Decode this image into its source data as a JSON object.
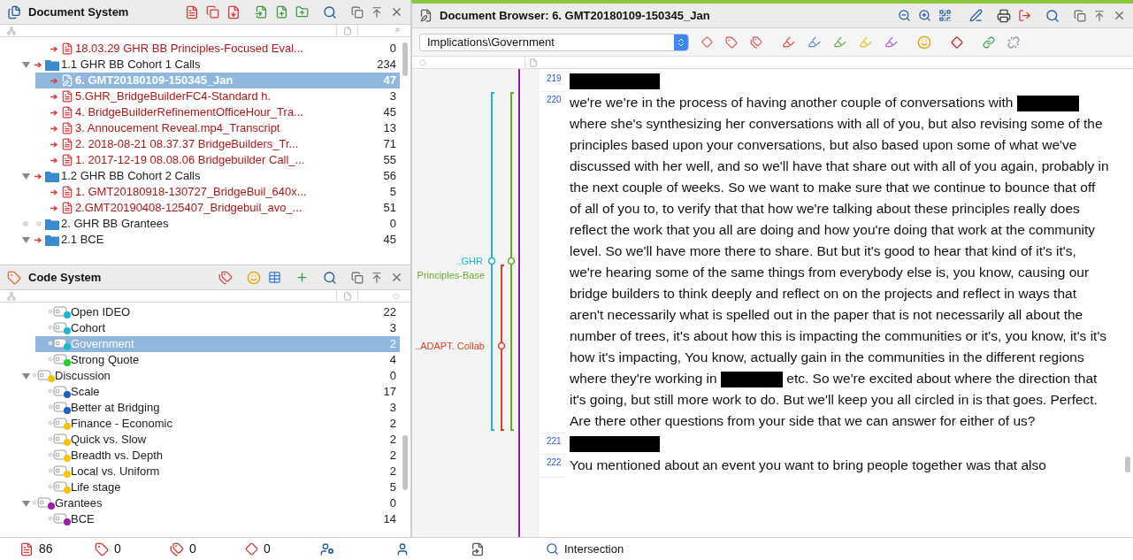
{
  "document_system": {
    "title": "Document System",
    "count_column": "#",
    "items": [
      {
        "children": [
          {
            "name": "18.03.29 GHR BB Principles-Focused Eval...",
            "kind": "pdf",
            "count": "0",
            "selected": false
          }
        ]
      },
      {
        "name": "1.1 GHR BB Cohort 1 Calls",
        "kind": "folder",
        "count": "234",
        "expanded": true,
        "selected": false,
        "children": [
          {
            "name": "6. GMT20180109-150345_Jan",
            "kind": "edited",
            "count": "47",
            "selected": true
          },
          {
            "name": "5.GHR_BridgeBuilderFC4-Standard h.",
            "kind": "text",
            "count": "3",
            "selected": false
          },
          {
            "name": "4. BridgeBuilderRefinementOfficeHour_Tra...",
            "kind": "text",
            "count": "45",
            "selected": false
          },
          {
            "name": "3. Annoucement Reveal.mp4_Transcript",
            "kind": "text",
            "count": "13",
            "selected": false
          },
          {
            "name": "2. 2018-08-21 08.37.37 BridgeBuilders_Tr...",
            "kind": "text",
            "count": "71",
            "selected": false
          },
          {
            "name": "1. 2017-12-19 08.08.06 Bridgebuilder Call_...",
            "kind": "text",
            "count": "55",
            "selected": false
          }
        ]
      },
      {
        "name": "1.2 GHR BB Cohort 2 Calls",
        "kind": "folder",
        "count": "56",
        "expanded": true,
        "selected": false,
        "children": [
          {
            "name": "1. GMT20180918-130727_BridgeBuil_640x...",
            "kind": "text",
            "count": "5",
            "selected": false
          },
          {
            "name": "2.GMT20190408-125407_Bridgebuil_avo_...",
            "kind": "text",
            "count": "51",
            "selected": false
          }
        ]
      },
      {
        "name": "2. GHR BB Grantees",
        "kind": "folder",
        "count": "0",
        "expanded": false,
        "selected": false
      },
      {
        "name": "2.1 BCE",
        "kind": "folder",
        "count": "45",
        "expanded": true,
        "selected": false
      }
    ]
  },
  "code_system": {
    "title": "Code System",
    "items": [
      {
        "children": [
          {
            "name": "Open IDEO",
            "count": "22",
            "color": "#1bb8d4",
            "selected": false
          },
          {
            "name": "Cohort",
            "count": "3",
            "color": "#1bb8d4",
            "selected": false
          },
          {
            "name": "Government",
            "count": "2",
            "color": "#1bb8d4",
            "selected": true
          },
          {
            "name": "Strong Quote",
            "count": "4",
            "color": "#22d022",
            "selected": false
          }
        ]
      },
      {
        "name": "Discussion",
        "count": "0",
        "color": "#f2c500",
        "expanded": true,
        "selected": false,
        "children": [
          {
            "name": "Scale",
            "count": "17",
            "color": "#1f5fbf",
            "selected": false
          },
          {
            "name": "Better at Bridging",
            "count": "3",
            "color": "#1f5fbf",
            "selected": false
          },
          {
            "name": "Finance - Economic",
            "count": "2",
            "color": "#f2c500",
            "selected": false
          },
          {
            "name": "Quick vs. Slow",
            "count": "2",
            "color": "#f2c500",
            "selected": false
          },
          {
            "name": "Breadth vs. Depth",
            "count": "2",
            "color": "#f2c500",
            "selected": false
          },
          {
            "name": "Local vs. Uniform",
            "count": "2",
            "color": "#f2c500",
            "selected": false
          },
          {
            "name": "Life stage",
            "count": "5",
            "color": "#f2c500",
            "selected": false
          }
        ]
      },
      {
        "name": "Grantees",
        "count": "0",
        "color": "#9b1fa8",
        "expanded": true,
        "selected": false,
        "children": [
          {
            "name": "BCE",
            "count": "14",
            "color": "#9b1fa8",
            "selected": false
          }
        ]
      }
    ]
  },
  "document_browser": {
    "title": "Document Browser: 6. GMT20180109-150345_Jan",
    "code_select": {
      "value": "Implications\\Government"
    },
    "coding_stripes": [
      {
        "label": "..GHR",
        "color": "#1bb8d4"
      },
      {
        "label": "Principles-Base",
        "color": "#6aa832"
      },
      {
        "label": "..ADAPT. Collab",
        "color": "#e0402a"
      }
    ],
    "paragraphs": [
      {
        "line": "219",
        "segments": [
          {
            "kind": "redacted"
          }
        ]
      },
      {
        "line": "220",
        "segments": [
          {
            "kind": "text",
            "text": "we're we're in the process of having another couple of conversations with "
          },
          {
            "kind": "redacted"
          },
          {
            "kind": "text",
            "text": " where she's synthesizing her conversations with all of you, but also revising some of the principles based upon your conversations, but also based upon some of what we've discussed with her well, and so we'll have that share out with all of you again, probably in the next couple of weeks. So we want to make sure that we continue to bounce that off of all of you to, to verify that that how we're talking about these principles really does reflect the work that you all are doing and how you're doing that work at the community level. So we'll have more there to share. But but it's good to hear that kind of it's it's, we're hearing some of the same things from everybody else is, you know, causing our bridge builders to think deeply and reflect on on the projects and reflect in ways that aren't necessarily what is spelled out in the paper that is not necessarily all about the number of trees, it's about how this is impacting the communities or it's, you know, it's it's how it's impacting, You know, actually gain in the communities in the different regions where they're working in "
          },
          {
            "kind": "redacted"
          },
          {
            "kind": "text",
            "text": " etc. So we're excited about where the direction that it's going, but still more work to do. But we'll keep you all circled in is that goes. Perfect. Are there other questions from your side that we can answer for either of us?"
          }
        ]
      },
      {
        "line": "221",
        "segments": [
          {
            "kind": "redacted"
          }
        ]
      },
      {
        "line": "222",
        "segments": [
          {
            "kind": "text",
            "text": "You mentioned about an event you want to bring people together was that also"
          }
        ]
      }
    ]
  },
  "status_bar": [
    {
      "kind": "documents",
      "count": "86"
    },
    {
      "kind": "memos",
      "count": "0"
    },
    {
      "kind": "codes",
      "count": "0"
    },
    {
      "kind": "segments",
      "count": "0"
    },
    {
      "kind": "user-tool"
    },
    {
      "kind": "user"
    },
    {
      "kind": "doc-export"
    },
    {
      "kind": "intersection",
      "label": "Intersection"
    }
  ]
}
